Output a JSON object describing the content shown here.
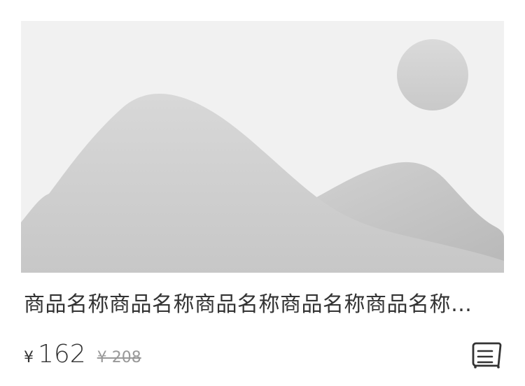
{
  "product": {
    "image_icon": "image-placeholder-icon",
    "title": "商品名称商品名称商品名称商品名称商品名称商品名称商品名称商品名称",
    "currency": "¥",
    "price": "162",
    "original_price": "¥ 208",
    "action_icon": "list-icon"
  },
  "colors": {
    "placeholder_bg": "#f1f1f1",
    "mountain": "#cccccc",
    "sun": "#d2d2d2",
    "text": "#333333",
    "muted_text": "#999999"
  }
}
